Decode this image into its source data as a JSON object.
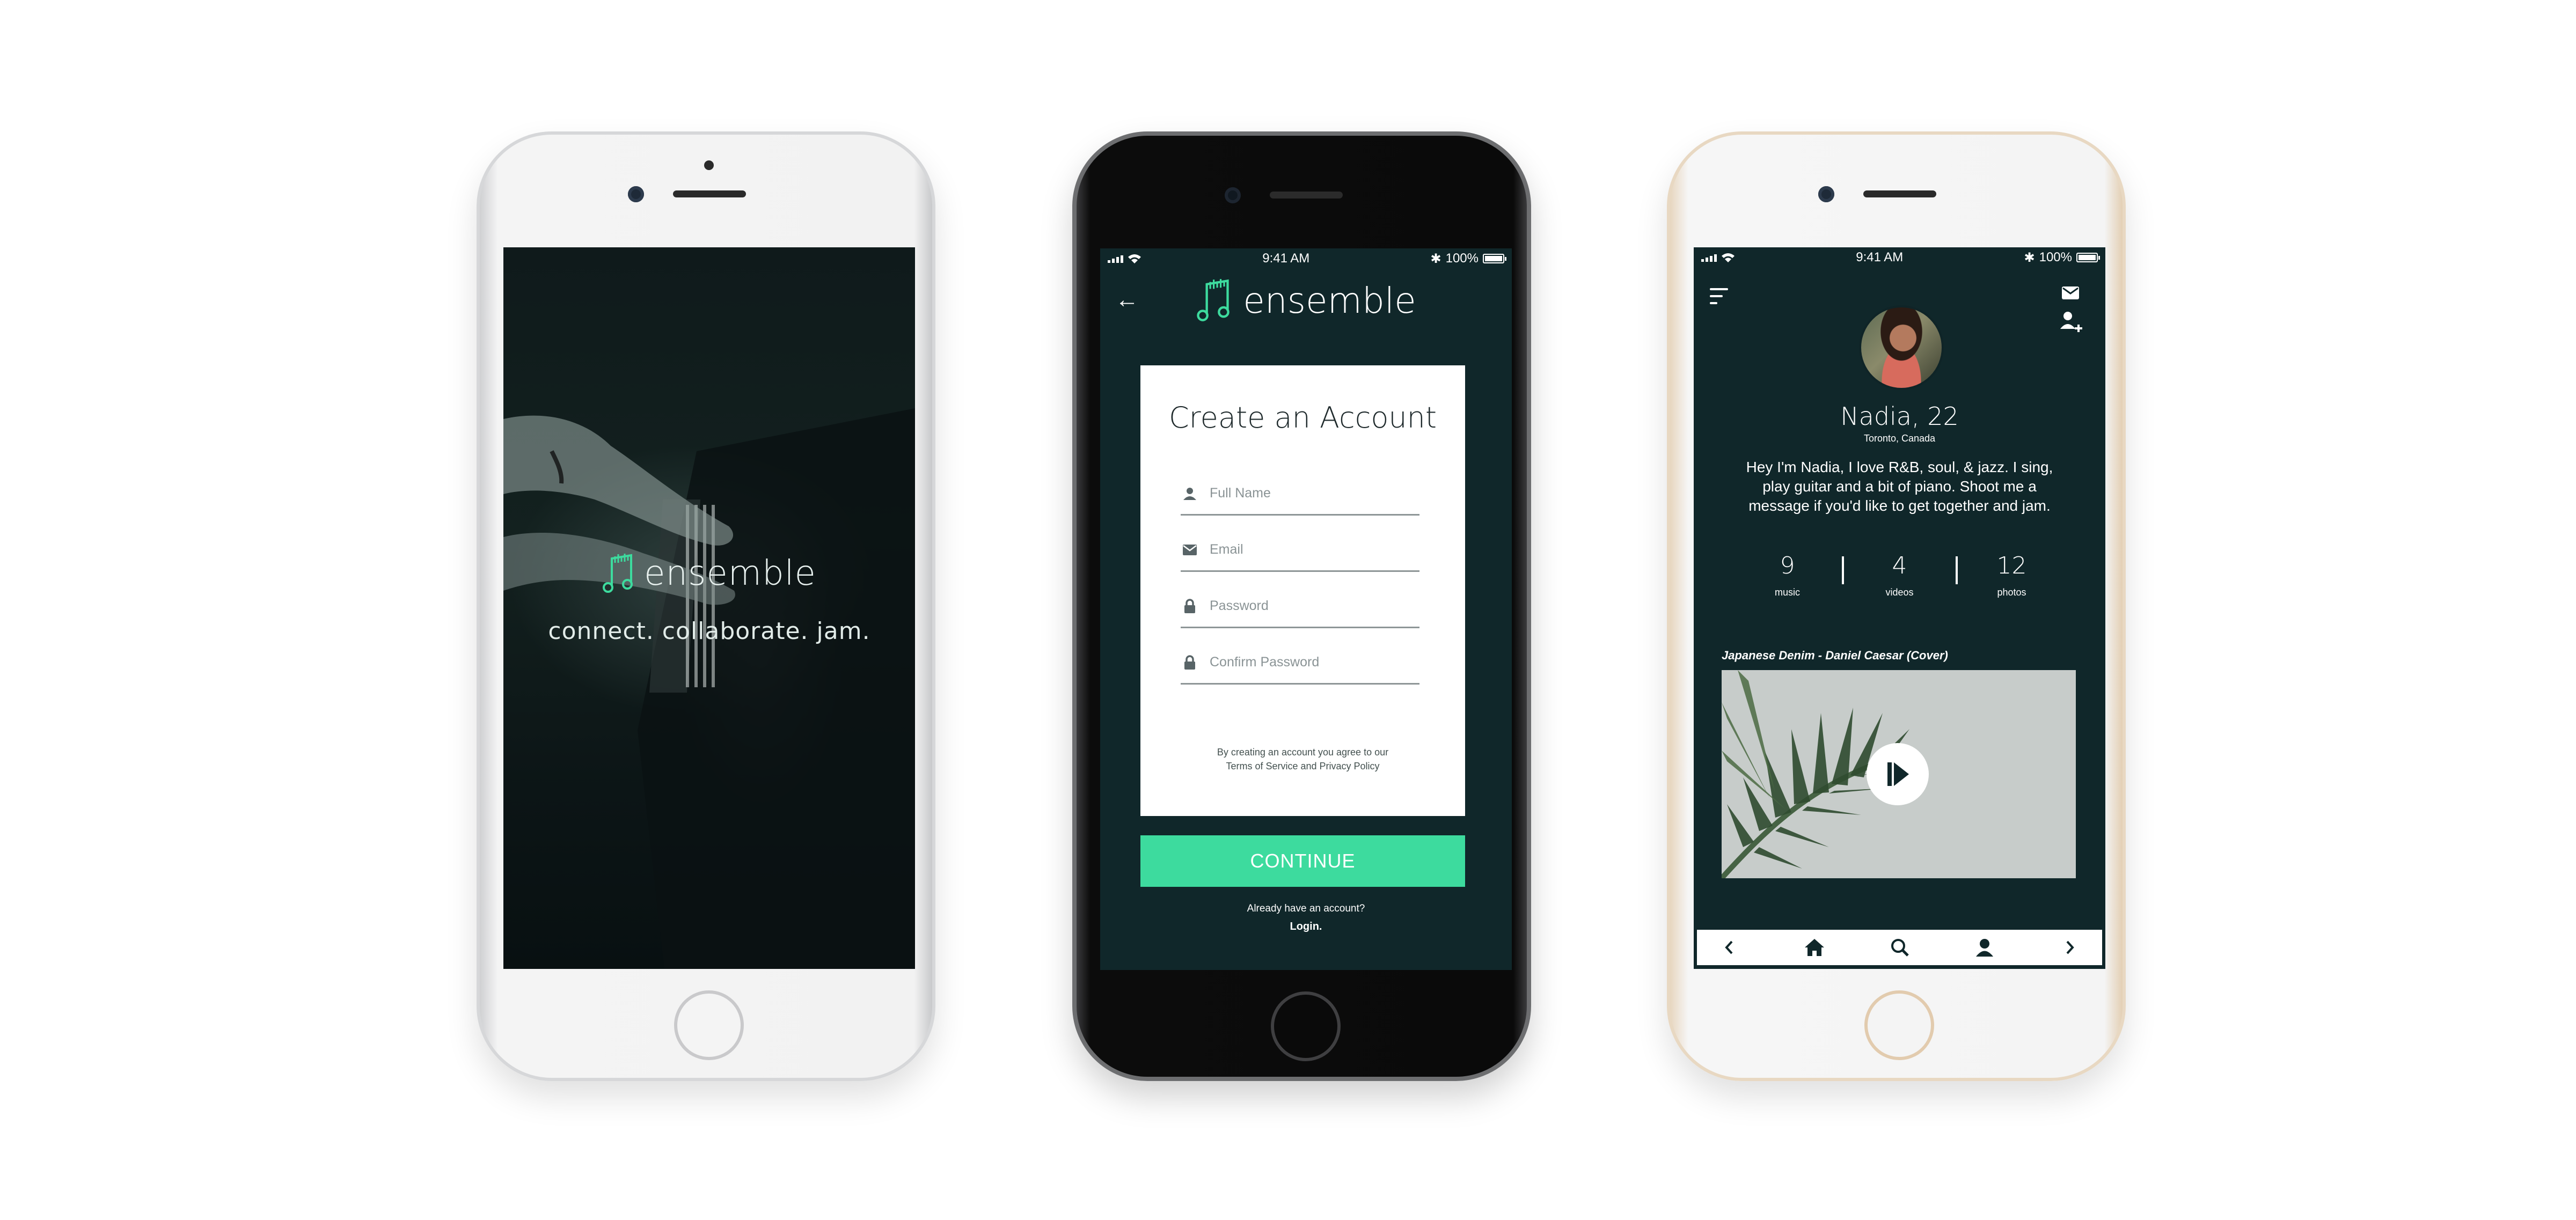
{
  "colors": {
    "app_background": "#10272a",
    "accent": "#3ddb9e",
    "card": "#ffffff"
  },
  "splash": {
    "logo_text": "ensemble",
    "tagline": "connect. collaborate. jam."
  },
  "signup": {
    "status_bar": {
      "time": "9:41 AM",
      "battery": "100%"
    },
    "header_logo_text": "ensemble",
    "back_icon": "arrow-left-icon",
    "form_title": "Create an Account",
    "fields": [
      {
        "icon": "person-icon",
        "placeholder": "Full Name"
      },
      {
        "icon": "envelope-icon",
        "placeholder": "Email"
      },
      {
        "icon": "lock-icon",
        "placeholder": "Password"
      },
      {
        "icon": "lock-icon",
        "placeholder": "Confirm Password"
      }
    ],
    "terms_line1": "By creating an account you agree to our",
    "terms_line2": "Terms of Service and Privacy Policy",
    "continue_label": "CONTINUE",
    "already_text": "Already have an account?",
    "login_label": "Login."
  },
  "profile": {
    "status_bar": {
      "time": "9:41 AM",
      "battery": "100%"
    },
    "name": "Nadia, 22",
    "location": "Toronto, Canada",
    "bio": "Hey I'm Nadia, I love R&B, soul, & jazz. I sing, play guitar and a bit of piano. Shoot me a message if you'd like to get together and jam.",
    "stats": [
      {
        "value": "9",
        "label": "music"
      },
      {
        "value": "4",
        "label": "videos"
      },
      {
        "value": "12",
        "label": "photos"
      }
    ],
    "video_title": "Japanese Denim - Daniel Caesar (Cover)",
    "nav_icons": [
      "chevron-left-icon",
      "home-icon",
      "search-icon",
      "user-icon",
      "chevron-right-icon"
    ]
  }
}
